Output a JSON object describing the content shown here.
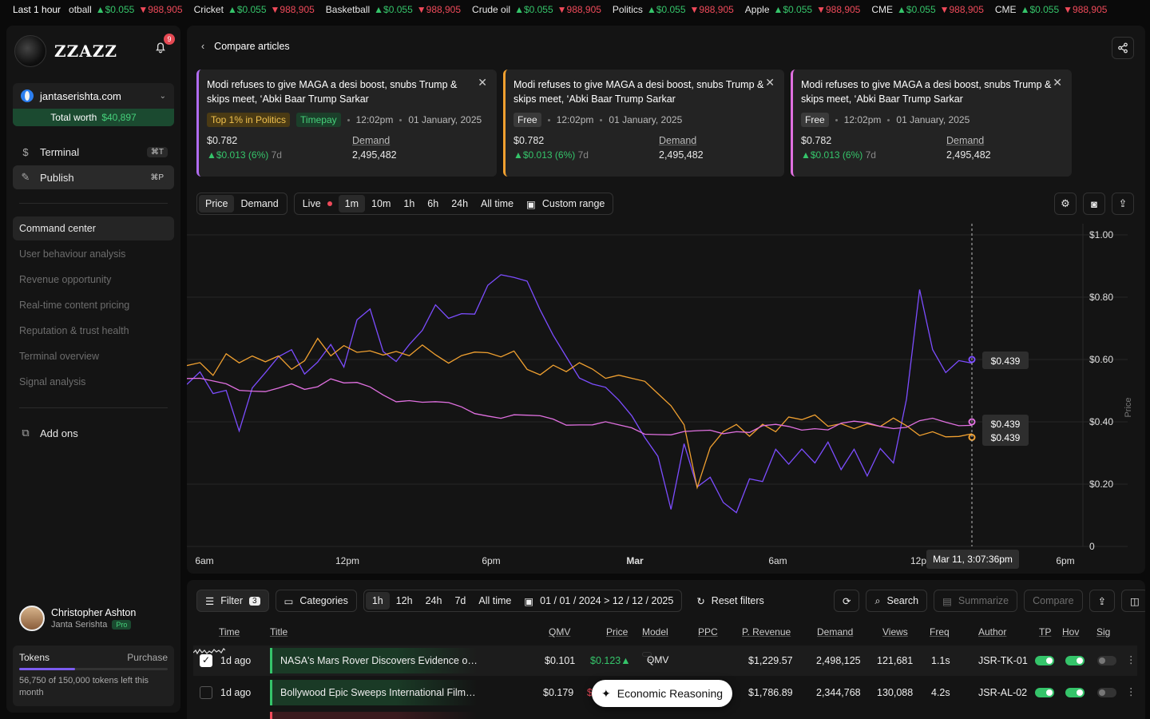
{
  "ticker": {
    "lead": "Last 1 hour",
    "items": [
      {
        "name": "otball",
        "up": "▲$0.055",
        "down": "▼988,905"
      },
      {
        "name": "Cricket",
        "up": "▲$0.055",
        "down": "▼988,905"
      },
      {
        "name": "Basketball",
        "up": "▲$0.055",
        "down": "▼988,905"
      },
      {
        "name": "Crude oil",
        "up": "▲$0.055",
        "down": "▼988,905"
      },
      {
        "name": "Politics",
        "up": "▲$0.055",
        "down": "▼988,905"
      },
      {
        "name": "Apple",
        "up": "▲$0.055",
        "down": "▼988,905"
      },
      {
        "name": "CME",
        "up": "▲$0.055",
        "down": "▼988,905"
      },
      {
        "name": "CME",
        "up": "▲$0.055",
        "down": "▼988,905"
      }
    ]
  },
  "sidebar": {
    "brand": "ZZAZZ",
    "notif_count": "9",
    "site": "jantaserishta.com",
    "worth_label": "Total worth",
    "worth_value": "$40,897",
    "primary": [
      {
        "label": "Terminal",
        "kbd": "⌘T",
        "icon": "dollar-icon"
      },
      {
        "label": "Publish",
        "kbd": "⌘P",
        "icon": "pen-icon"
      }
    ],
    "menu": [
      "Command center",
      "User behaviour analysis",
      "Revenue opportunity",
      "Real-time content pricing",
      "Reputation & trust health",
      "Terminal overview",
      "Signal analysis"
    ],
    "addons": "Add ons",
    "user_name": "Christopher Ashton",
    "user_org": "Janta Serishta",
    "user_plan": "Pro",
    "tokens_label": "Tokens",
    "purchase_label": "Purchase",
    "tokens_used_fraction": 0.378,
    "tokens_text": "56,750 of 150,000 tokens left this month"
  },
  "header": {
    "title": "Compare articles"
  },
  "cards": [
    {
      "title": "Modi refuses to give MAGA a desi boost, snubs Trump & skips meet, ‘Abki Baar Trump Sarkar",
      "tags": [
        "Top 1% in Politics",
        "Timepay"
      ],
      "time": "12:02pm",
      "date": "01 January, 2025",
      "price": "$0.782",
      "delta": "▲$0.013 (6%)",
      "delta_period": "7d",
      "demand_label": "Demand",
      "demand": "2,495,482",
      "accent": "#b06cf0"
    },
    {
      "title": "Modi refuses to give MAGA a desi boost, snubs Trump & skips meet, ‘Abki Baar Trump Sarkar",
      "tags": [
        "Free"
      ],
      "time": "12:02pm",
      "date": "01 January, 2025",
      "price": "$0.782",
      "delta": "▲$0.013 (6%)",
      "delta_period": "7d",
      "demand_label": "Demand",
      "demand": "2,495,482",
      "accent": "#f0a030"
    },
    {
      "title": "Modi refuses to give MAGA a desi boost, snubs Trump & skips meet, ‘Abki Baar Trump Sarkar",
      "tags": [
        "Free"
      ],
      "time": "12:02pm",
      "date": "01 January, 2025",
      "price": "$0.782",
      "delta": "▲$0.013 (6%)",
      "delta_period": "7d",
      "demand_label": "Demand",
      "demand": "2,495,482",
      "accent": "#e070e0"
    }
  ],
  "chart_toolbar": {
    "metrics": [
      "Price",
      "Demand"
    ],
    "live": "Live",
    "ranges": [
      "1m",
      "10m",
      "1h",
      "6h",
      "24h",
      "All time"
    ],
    "custom": "Custom range"
  },
  "chart_data": {
    "type": "line",
    "ylabel": "Price",
    "yticks": [
      "$1.00",
      "$0.80",
      "$0.60",
      "$0.40",
      "$0.20",
      "0"
    ],
    "ylim": [
      0,
      1
    ],
    "xticks": [
      "6am",
      "12pm",
      "6pm",
      "Mar",
      "6am",
      "12p",
      "6pm"
    ],
    "cursor_label": "Mar 11, 3:07:36pm",
    "end_labels": [
      "$0.439",
      "$0.439",
      "$0.439"
    ],
    "series": [
      {
        "color": "#7c4dff",
        "values": [
          0.52,
          0.55,
          0.48,
          0.5,
          0.38,
          0.52,
          0.56,
          0.6,
          0.62,
          0.55,
          0.6,
          0.66,
          0.58,
          0.72,
          0.75,
          0.62,
          0.6,
          0.66,
          0.7,
          0.77,
          0.72,
          0.74,
          0.75,
          0.85,
          0.88,
          0.86,
          0.84,
          0.75,
          0.68,
          0.62,
          0.55,
          0.52,
          0.5,
          0.46,
          0.42,
          0.36,
          0.3,
          0.12,
          0.32,
          0.18,
          0.22,
          0.15,
          0.12,
          0.22,
          0.2,
          0.3,
          0.26,
          0.32,
          0.28,
          0.34,
          0.24,
          0.3,
          0.22,
          0.32,
          0.28,
          0.48,
          0.82,
          0.62,
          0.55,
          0.6,
          0.6
        ]
      },
      {
        "color": "#f0a030",
        "values": [
          0.58,
          0.6,
          0.56,
          0.62,
          0.58,
          0.6,
          0.59,
          0.62,
          0.58,
          0.6,
          0.66,
          0.6,
          0.64,
          0.63,
          0.64,
          0.62,
          0.62,
          0.6,
          0.64,
          0.62,
          0.6,
          0.62,
          0.62,
          0.61,
          0.6,
          0.63,
          0.58,
          0.56,
          0.58,
          0.55,
          0.58,
          0.57,
          0.55,
          0.56,
          0.54,
          0.52,
          0.48,
          0.45,
          0.4,
          0.2,
          0.32,
          0.36,
          0.38,
          0.35,
          0.4,
          0.38,
          0.42,
          0.4,
          0.41,
          0.38,
          0.4,
          0.39,
          0.4,
          0.38,
          0.4,
          0.38,
          0.36,
          0.38,
          0.36,
          0.35,
          0.35
        ]
      },
      {
        "color": "#e070e0",
        "values": [
          0.54,
          0.53,
          0.52,
          0.52,
          0.51,
          0.51,
          0.5,
          0.5,
          0.51,
          0.5,
          0.52,
          0.55,
          0.53,
          0.52,
          0.5,
          0.48,
          0.47,
          0.48,
          0.47,
          0.46,
          0.45,
          0.44,
          0.43,
          0.43,
          0.42,
          0.42,
          0.41,
          0.41,
          0.41,
          0.4,
          0.4,
          0.39,
          0.39,
          0.38,
          0.38,
          0.37,
          0.37,
          0.36,
          0.36,
          0.36,
          0.37,
          0.37,
          0.38,
          0.37,
          0.38,
          0.38,
          0.38,
          0.38,
          0.39,
          0.38,
          0.39,
          0.39,
          0.39,
          0.39,
          0.39,
          0.39,
          0.4,
          0.4,
          0.39,
          0.39,
          0.4
        ]
      }
    ]
  },
  "filter_bar": {
    "filter": "Filter",
    "filter_count": "3",
    "categories": "Categories",
    "ranges": [
      "1h",
      "12h",
      "24h",
      "7d",
      "All time"
    ],
    "date_range": "01 / 01 / 2024 > 12 / 12 / 2025",
    "reset": "Reset filters",
    "search": "Search",
    "summarize": "Summarize",
    "compare": "Compare"
  },
  "table": {
    "headers": [
      "Time",
      "Title",
      "QMV",
      "Price",
      "Model",
      "PPC",
      "P. Revenue",
      "Demand",
      "Views",
      "Freq",
      "Author",
      "TP",
      "Hov",
      "Sig"
    ],
    "rows": [
      {
        "checked": true,
        "time": "1d ago",
        "title": "NASA's Mars Rover Discovers Evidence of Ancient Life",
        "qmv": "$0.101",
        "price": "$0.123▲",
        "model": "QMV",
        "revenue": "$1,229.57",
        "demand": "2,498,125",
        "views": "121,681",
        "freq": "1.1s",
        "author": "JSR-TK-01"
      },
      {
        "checked": false,
        "time": "1d ago",
        "title": "Bollywood Epic Sweeps International Film Festival Aw...",
        "qmv": "$0.179",
        "price": "$",
        "model": "",
        "revenue": "$1,786.89",
        "demand": "2,344,768",
        "views": "130,088",
        "freq": "4.2s",
        "author": "JSR-AL-02"
      }
    ]
  },
  "floating": {
    "label": "Economic Reasoning"
  }
}
